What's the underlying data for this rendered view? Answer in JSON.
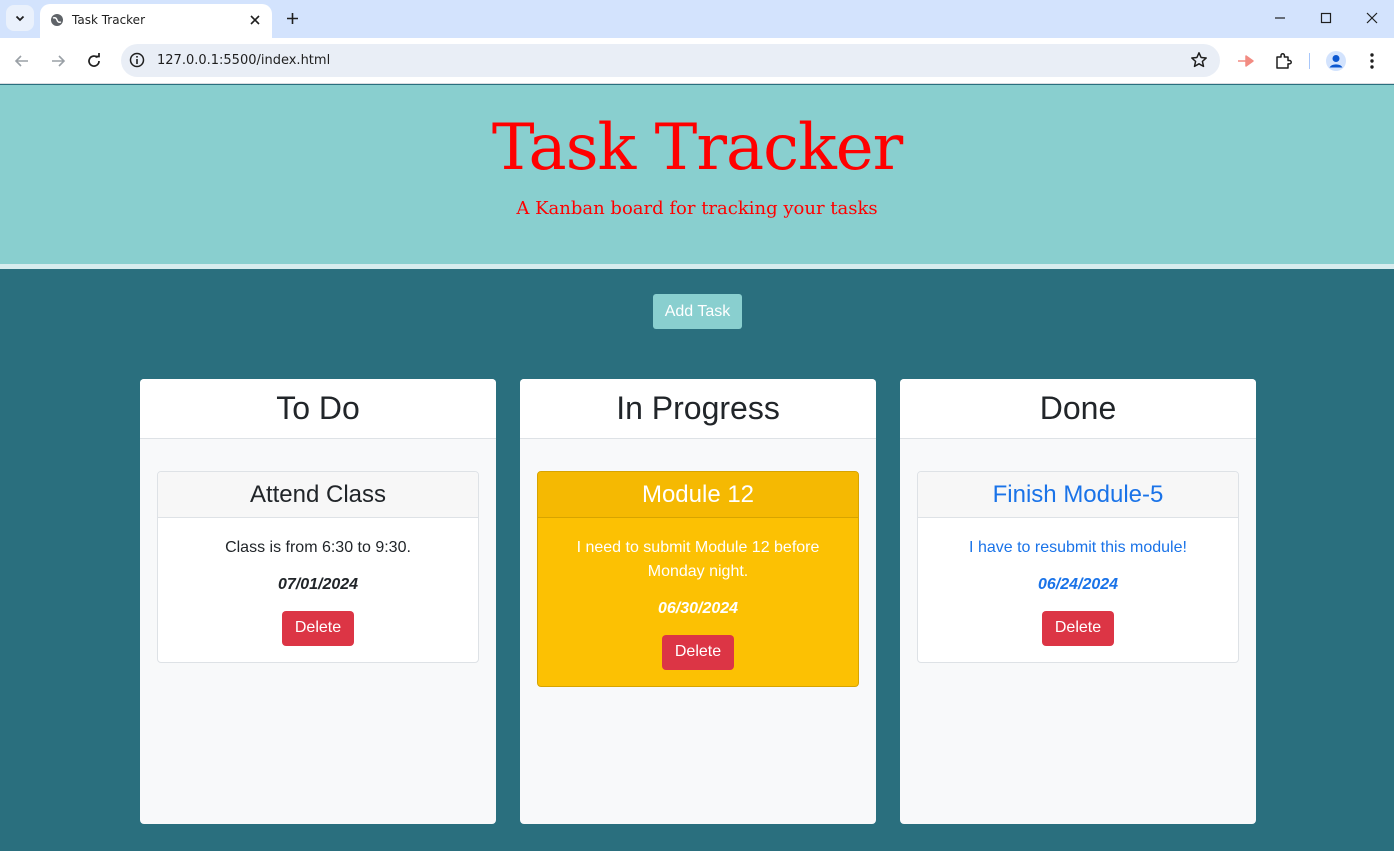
{
  "browser": {
    "tab_title": "Task Tracker",
    "url": "127.0.0.1:5500/index.html"
  },
  "header": {
    "title": "Task Tracker",
    "subtitle": "A Kanban board for tracking your tasks"
  },
  "add_task_label": "Add Task",
  "lanes": [
    {
      "title": "To Do",
      "cards": [
        {
          "title": "Attend Class",
          "description": "Class is from 6:30 to 9:30.",
          "date": "07/01/2024",
          "delete_label": "Delete"
        }
      ]
    },
    {
      "title": "In Progress",
      "cards": [
        {
          "title": "Module 12",
          "description": "I need to submit Module 12 before Monday night.",
          "date": "06/30/2024",
          "delete_label": "Delete"
        }
      ]
    },
    {
      "title": "Done",
      "cards": [
        {
          "title": "Finish Module-5",
          "description": "I have to resubmit this module!",
          "date": "06/24/2024",
          "delete_label": "Delete"
        }
      ]
    }
  ],
  "colors": {
    "page_bg": "#2a6f7e",
    "header_bg": "#89cfcf",
    "header_text": "#ff0000",
    "in_progress_card": "#fcc103",
    "done_text": "#1a73e8",
    "delete_button": "#dc3545"
  }
}
